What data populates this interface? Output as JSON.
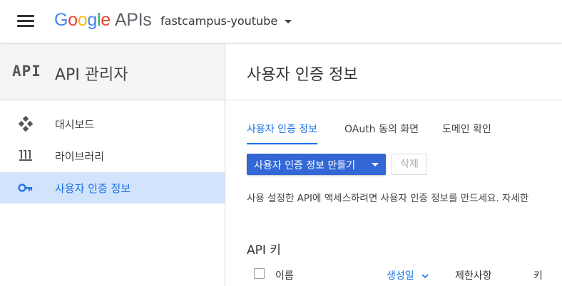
{
  "header": {
    "logo_letters": [
      "G",
      "o",
      "o",
      "g",
      "l",
      "e"
    ],
    "logo_suffix": "APIs",
    "project_name": "fastcampus-youtube"
  },
  "sidebar": {
    "brand_mark": "API",
    "title": "API 관리자",
    "items": [
      {
        "label": "대시보드",
        "icon": "dashboard-icon",
        "active": false
      },
      {
        "label": "라이브러리",
        "icon": "library-icon",
        "active": false
      },
      {
        "label": "사용자 인증 정보",
        "icon": "key-icon",
        "active": true
      }
    ]
  },
  "main": {
    "page_title": "사용자 인증 정보",
    "tabs": [
      {
        "label": "사용자 인증 정보",
        "active": true
      },
      {
        "label": "OAuth 동의 화면",
        "active": false
      },
      {
        "label": "도메인 확인",
        "active": false
      }
    ],
    "create_button_label": "사용자 인증 정보 만들기",
    "delete_button_label": "삭제",
    "description": "사용 설정한 API에 액세스하려면 사용자 인증 정보를 만드세요. 자세한",
    "section_title": "API 키",
    "table_headers": [
      "이름",
      "생성일",
      "제한사항",
      "키"
    ]
  },
  "colors": {
    "accent": "#1a73e8",
    "button": "#3367d6",
    "active_nav_bg": "#d2e3fc"
  }
}
